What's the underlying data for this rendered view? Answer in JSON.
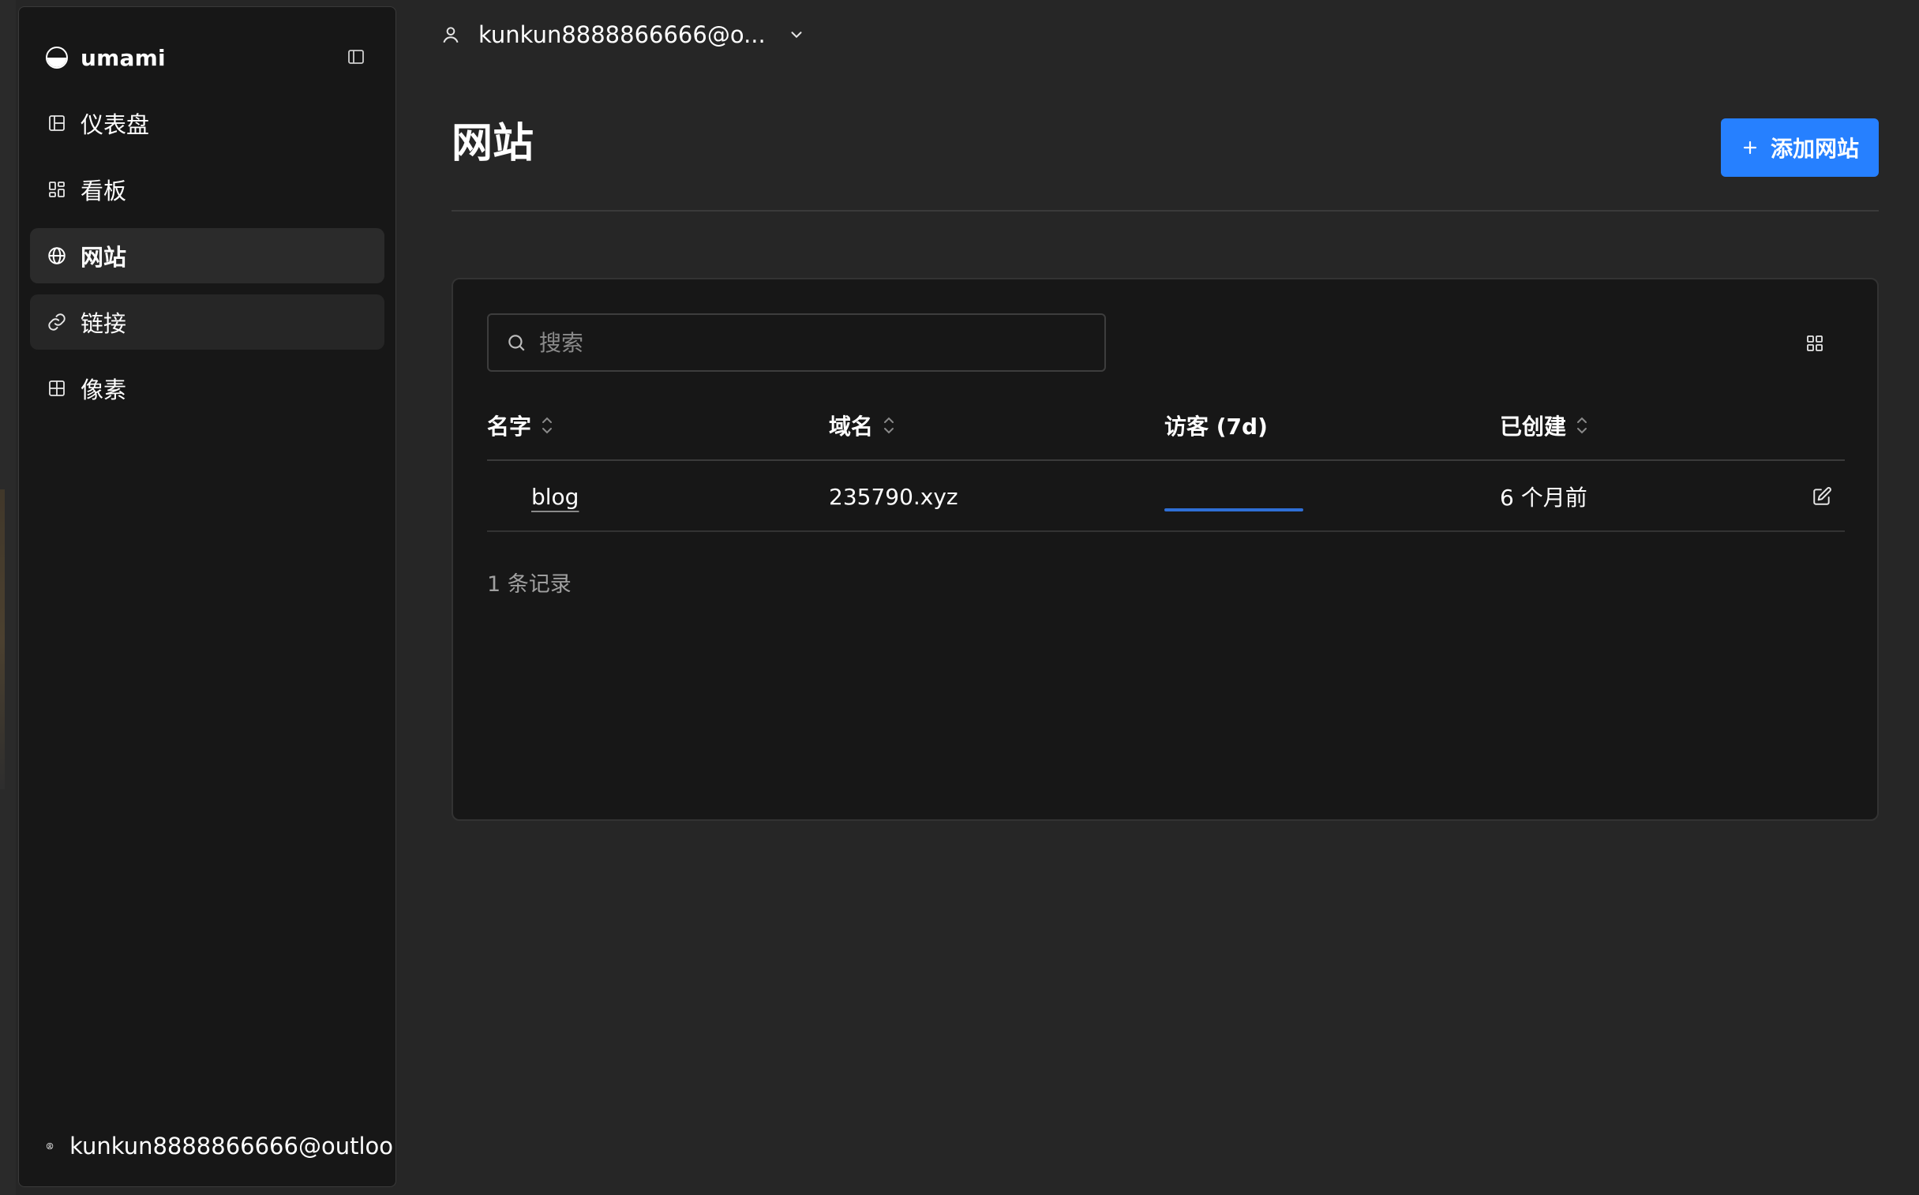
{
  "sidebar": {
    "brand": "umami",
    "items": [
      {
        "label": "仪表盘",
        "icon": "dashboard-icon"
      },
      {
        "label": "看板",
        "icon": "boards-icon"
      },
      {
        "label": "网站",
        "icon": "globe-icon"
      },
      {
        "label": "链接",
        "icon": "link-icon"
      },
      {
        "label": "像素",
        "icon": "pixel-grid-icon"
      }
    ],
    "active_item": "网站",
    "user": "kunkun8888866666@outloo"
  },
  "topbar": {
    "user": "kunkun8888866666@o..."
  },
  "header": {
    "title": "网站",
    "add_button_label": "添加网站"
  },
  "search": {
    "placeholder": "搜索",
    "value": ""
  },
  "table": {
    "columns": [
      "名字",
      "域名",
      "访客 (7d)",
      "已创建"
    ],
    "rows": [
      {
        "name": "blog",
        "domain": "235790.xyz",
        "created": "6 个月前"
      }
    ]
  },
  "footer": {
    "count": "1 条记录"
  },
  "colors": {
    "accent": "#2680ff",
    "background": "#262626",
    "panel": "#171717"
  }
}
